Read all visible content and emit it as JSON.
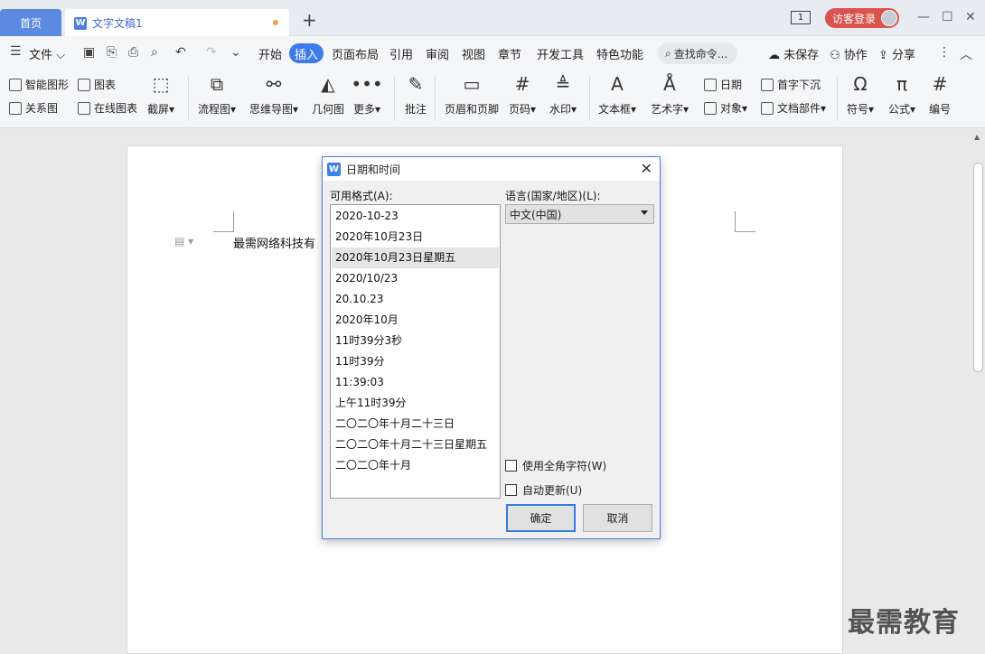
{
  "titlebar": {
    "home_tab": "首页",
    "doc_tab": "文字文稿1",
    "doc_icon_letter": "W",
    "add_tab": "+",
    "page_indicator": "1",
    "login": "访客登录",
    "minimize": "—",
    "maximize": "☐",
    "close": "✕"
  },
  "menubar": {
    "file": "文件",
    "items": [
      "开始",
      "插入",
      "页面布局",
      "引用",
      "审阅",
      "视图",
      "章节",
      "开发工具",
      "特色功能"
    ],
    "active": "插入",
    "search": "查找命令...",
    "unsaved": "未保存",
    "collab": "协作",
    "share": "分享"
  },
  "ribbon": {
    "smart_shape": "智能图形",
    "chart": "图表",
    "relation": "关系图",
    "online_chart": "在线图表",
    "screenshot": "截屏",
    "flowchart": "流程图",
    "mindmap": "思维导图",
    "geometry": "几何图",
    "more": "更多",
    "comment": "批注",
    "header_footer": "页眉和页脚",
    "page_number": "页码",
    "watermark": "水印",
    "textbox": "文本框",
    "wordart": "艺术字",
    "date": "日期",
    "object": "对象",
    "dropcap": "首字下沉",
    "doc_parts": "文档部件",
    "symbol": "符号",
    "formula": "公式",
    "numbering": "编号"
  },
  "document": {
    "text": "最需网络科技有"
  },
  "dialog": {
    "title": "日期和时间",
    "formats_label": "可用格式(A):",
    "language_label": "语言(国家/地区)(L):",
    "language_value": "中文(中国)",
    "formats": [
      "2020-10-23",
      "2020年10月23日",
      "2020年10月23日星期五",
      "2020/10/23",
      "20.10.23",
      "2020年10月",
      "11时39分3秒",
      "11时39分",
      "11:39:03",
      "上午11时39分",
      "二〇二〇年十月二十三日",
      "二〇二〇年十月二十三日星期五",
      "二〇二〇年十月"
    ],
    "selected_index": 2,
    "fullwidth_label": "使用全角字符(W)",
    "autoupdate_label": "自动更新(U)",
    "ok": "确定",
    "cancel": "取消"
  },
  "watermark": "最需教育"
}
